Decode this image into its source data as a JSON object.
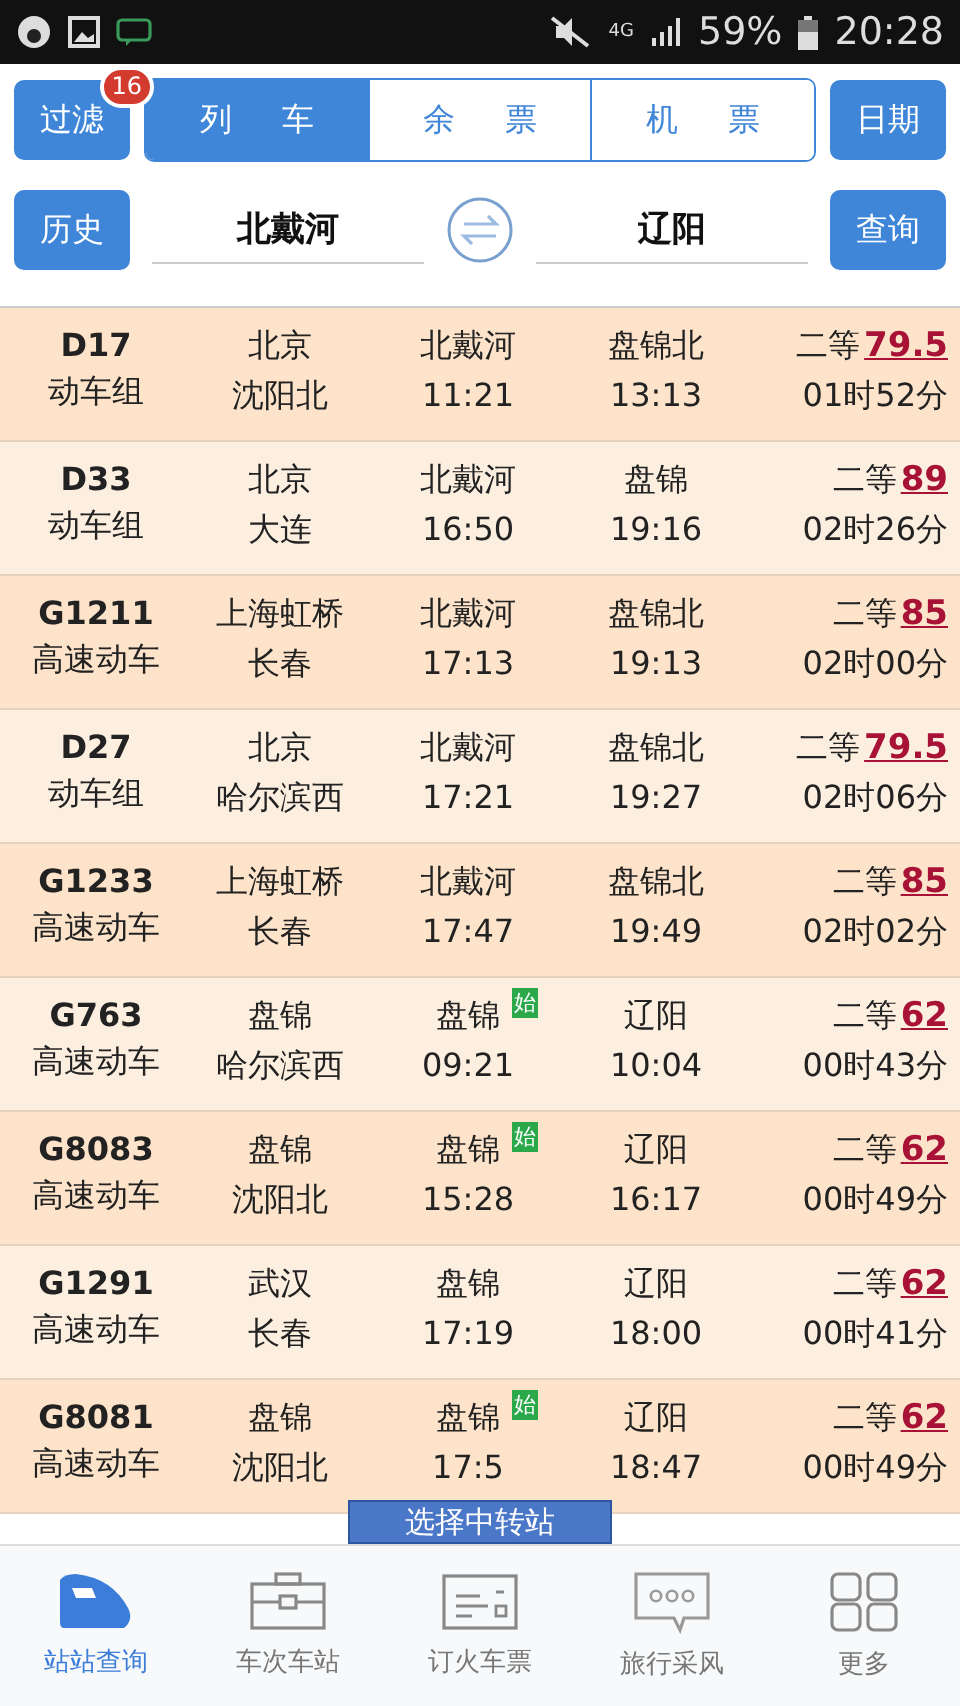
{
  "status_bar": {
    "network": "4G",
    "battery": "59%",
    "time": "20:28"
  },
  "toolbar": {
    "filter_button": "过滤",
    "filter_badge": "16",
    "tabs": [
      {
        "label": "列 车",
        "selected": true
      },
      {
        "label": "余 票",
        "selected": false
      },
      {
        "label": "机 票",
        "selected": false
      }
    ],
    "date_button": "日期"
  },
  "search": {
    "history_button": "历史",
    "from_station": "北戴河",
    "to_station": "辽阳",
    "query_button": "查询"
  },
  "trains": [
    {
      "number": "D17",
      "type": "动车组",
      "origin": "北京",
      "terminal": "沈阳北",
      "from": "北戴河",
      "departs": "11:21",
      "to": "盘锦北",
      "arrives": "13:13",
      "seat_class": "二等",
      "price": "79.5",
      "duration": "01时52分",
      "starts_here": false
    },
    {
      "number": "D33",
      "type": "动车组",
      "origin": "北京",
      "terminal": "大连",
      "from": "北戴河",
      "departs": "16:50",
      "to": "盘锦",
      "arrives": "19:16",
      "seat_class": "二等",
      "price": "89",
      "duration": "02时26分",
      "starts_here": false
    },
    {
      "number": "G1211",
      "type": "高速动车",
      "origin": "上海虹桥",
      "terminal": "长春",
      "from": "北戴河",
      "departs": "17:13",
      "to": "盘锦北",
      "arrives": "19:13",
      "seat_class": "二等",
      "price": "85",
      "duration": "02时00分",
      "starts_here": false
    },
    {
      "number": "D27",
      "type": "动车组",
      "origin": "北京",
      "terminal": "哈尔滨西",
      "from": "北戴河",
      "departs": "17:21",
      "to": "盘锦北",
      "arrives": "19:27",
      "seat_class": "二等",
      "price": "79.5",
      "duration": "02时06分",
      "starts_here": false
    },
    {
      "number": "G1233",
      "type": "高速动车",
      "origin": "上海虹桥",
      "terminal": "长春",
      "from": "北戴河",
      "departs": "17:47",
      "to": "盘锦北",
      "arrives": "19:49",
      "seat_class": "二等",
      "price": "85",
      "duration": "02时02分",
      "starts_here": false
    },
    {
      "number": "G763",
      "type": "高速动车",
      "origin": "盘锦",
      "terminal": "哈尔滨西",
      "from": "盘锦",
      "departs": "09:21",
      "to": "辽阳",
      "arrives": "10:04",
      "seat_class": "二等",
      "price": "62",
      "duration": "00时43分",
      "starts_here": true,
      "start_mark": "始"
    },
    {
      "number": "G8083",
      "type": "高速动车",
      "origin": "盘锦",
      "terminal": "沈阳北",
      "from": "盘锦",
      "departs": "15:28",
      "to": "辽阳",
      "arrives": "16:17",
      "seat_class": "二等",
      "price": "62",
      "duration": "00时49分",
      "starts_here": true,
      "start_mark": "始"
    },
    {
      "number": "G1291",
      "type": "高速动车",
      "origin": "武汉",
      "terminal": "长春",
      "from": "盘锦",
      "departs": "17:19",
      "to": "辽阳",
      "arrives": "18:00",
      "seat_class": "二等",
      "price": "62",
      "duration": "00时41分",
      "starts_here": false
    },
    {
      "number": "G8081",
      "type": "高速动车",
      "origin": "盘锦",
      "terminal": "沈阳北",
      "from": "盘锦",
      "departs": "17:5",
      "to": "辽阳",
      "arrives": "18:47",
      "seat_class": "二等",
      "price": "62",
      "duration": "00时49分",
      "starts_here": true,
      "start_mark": "始"
    }
  ],
  "transfer_button": "选择中转站",
  "bottom_nav": [
    {
      "label": "站站查询",
      "selected": true
    },
    {
      "label": "车次车站",
      "selected": false
    },
    {
      "label": "订火车票",
      "selected": false
    },
    {
      "label": "旅行采风",
      "selected": false
    },
    {
      "label": "更多",
      "selected": false
    }
  ]
}
